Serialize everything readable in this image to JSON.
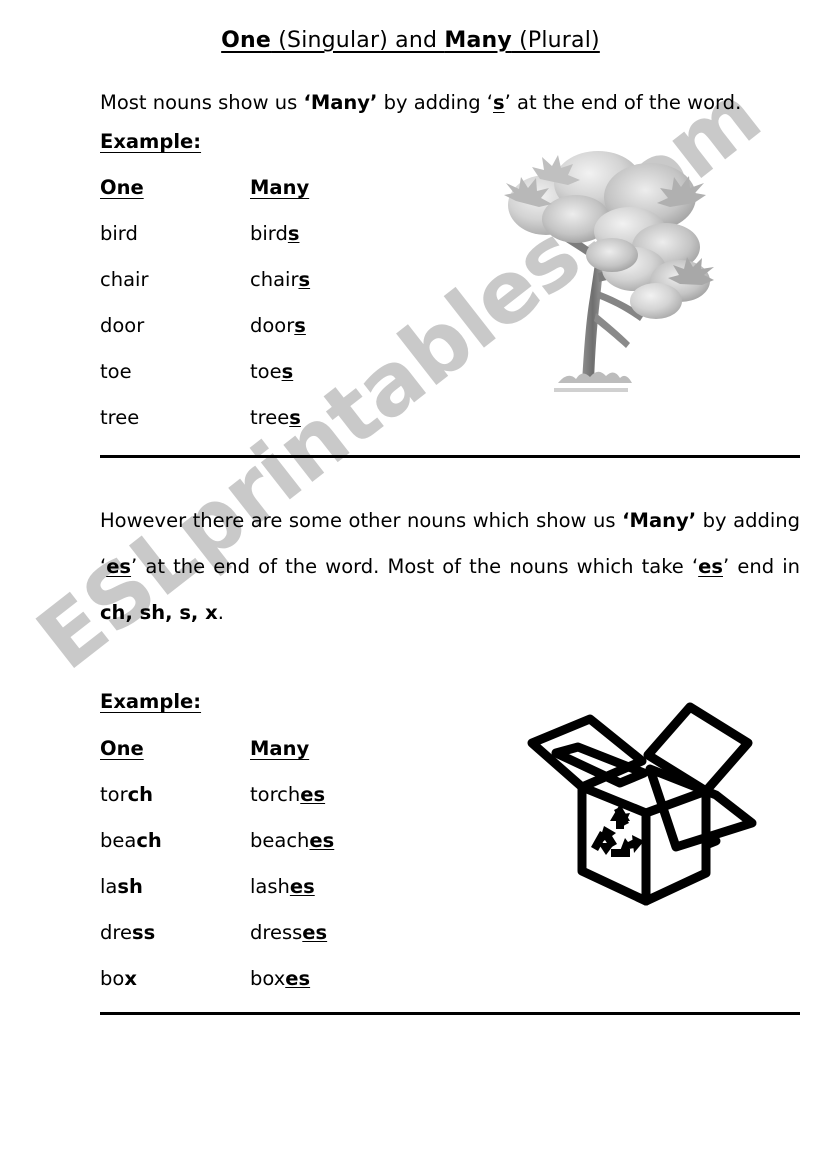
{
  "document": {
    "title_parts": [
      {
        "text": "One",
        "bold": true
      },
      {
        "text": " (Singular) and ",
        "bold": false
      },
      {
        "text": "Many",
        "bold": true
      },
      {
        "text": " (Plural)",
        "bold": false
      }
    ],
    "title_plain": "One (Singular) and Many (Plural)"
  },
  "watermark": {
    "text": "ESLprintables.com",
    "color": "#c9c9c9"
  },
  "intro": {
    "before": "Most nouns show us ",
    "emphasis_many": "‘Many’",
    "middle": " by adding ",
    "emphasis_s": "‘s’",
    "after": " at the end of the word.",
    "full_text": "Most nouns show us ‘Many’ by adding ‘s’ at the end of the word."
  },
  "section1": {
    "example_label": "Example:",
    "headers": {
      "one": "One",
      "many": "Many"
    },
    "rows": [
      {
        "one": "bird",
        "many_stem": "bird",
        "many_suffix": "s"
      },
      {
        "one": "chair",
        "many_stem": "chair",
        "many_suffix": "s"
      },
      {
        "one": "door",
        "many_stem": "door",
        "many_suffix": "s"
      },
      {
        "one": "toe",
        "many_stem": "toe",
        "many_suffix": "s"
      },
      {
        "one": "tree",
        "many_stem": "tree",
        "many_suffix": "s"
      }
    ]
  },
  "rule_text": {
    "part1": "However there are some other nouns which show us ",
    "emphasis_many": "‘Many’",
    "part2": " by adding ",
    "emphasis_es1": "‘es’",
    "part3": " at the end of the word. Most of the nouns which take ",
    "emphasis_es2": "‘es’",
    "part4": " end in ",
    "endings": "ch, sh, s, x",
    "period": ".",
    "full_text": "However there are some other nouns which show us ‘Many’ by adding ‘es’ at the end of the word. Most of the nouns which take ‘es’ end in ch, sh, s, x."
  },
  "section2": {
    "example_label": "Example:",
    "headers": {
      "one": "One",
      "many": "Many"
    },
    "rows": [
      {
        "one_stem": "tor",
        "one_end": "ch",
        "many_stem": "torch",
        "many_suffix": "es"
      },
      {
        "one_stem": "bea",
        "one_end": "ch",
        "many_stem": "beach",
        "many_suffix": "es"
      },
      {
        "one_stem": "la",
        "one_end": "sh",
        "many_stem": "lash",
        "many_suffix": "es"
      },
      {
        "one_stem": "dre",
        "one_end": "ss",
        "many_stem": "dress",
        "many_suffix": "es"
      },
      {
        "one_stem": "bo",
        "one_end": "x",
        "many_stem": "box",
        "many_suffix": "es"
      }
    ]
  },
  "images": {
    "tree": {
      "name": "tree-illustration",
      "alt": "tree"
    },
    "box": {
      "name": "open-box-illustration",
      "alt": "open cardboard box with recycle symbol"
    }
  }
}
